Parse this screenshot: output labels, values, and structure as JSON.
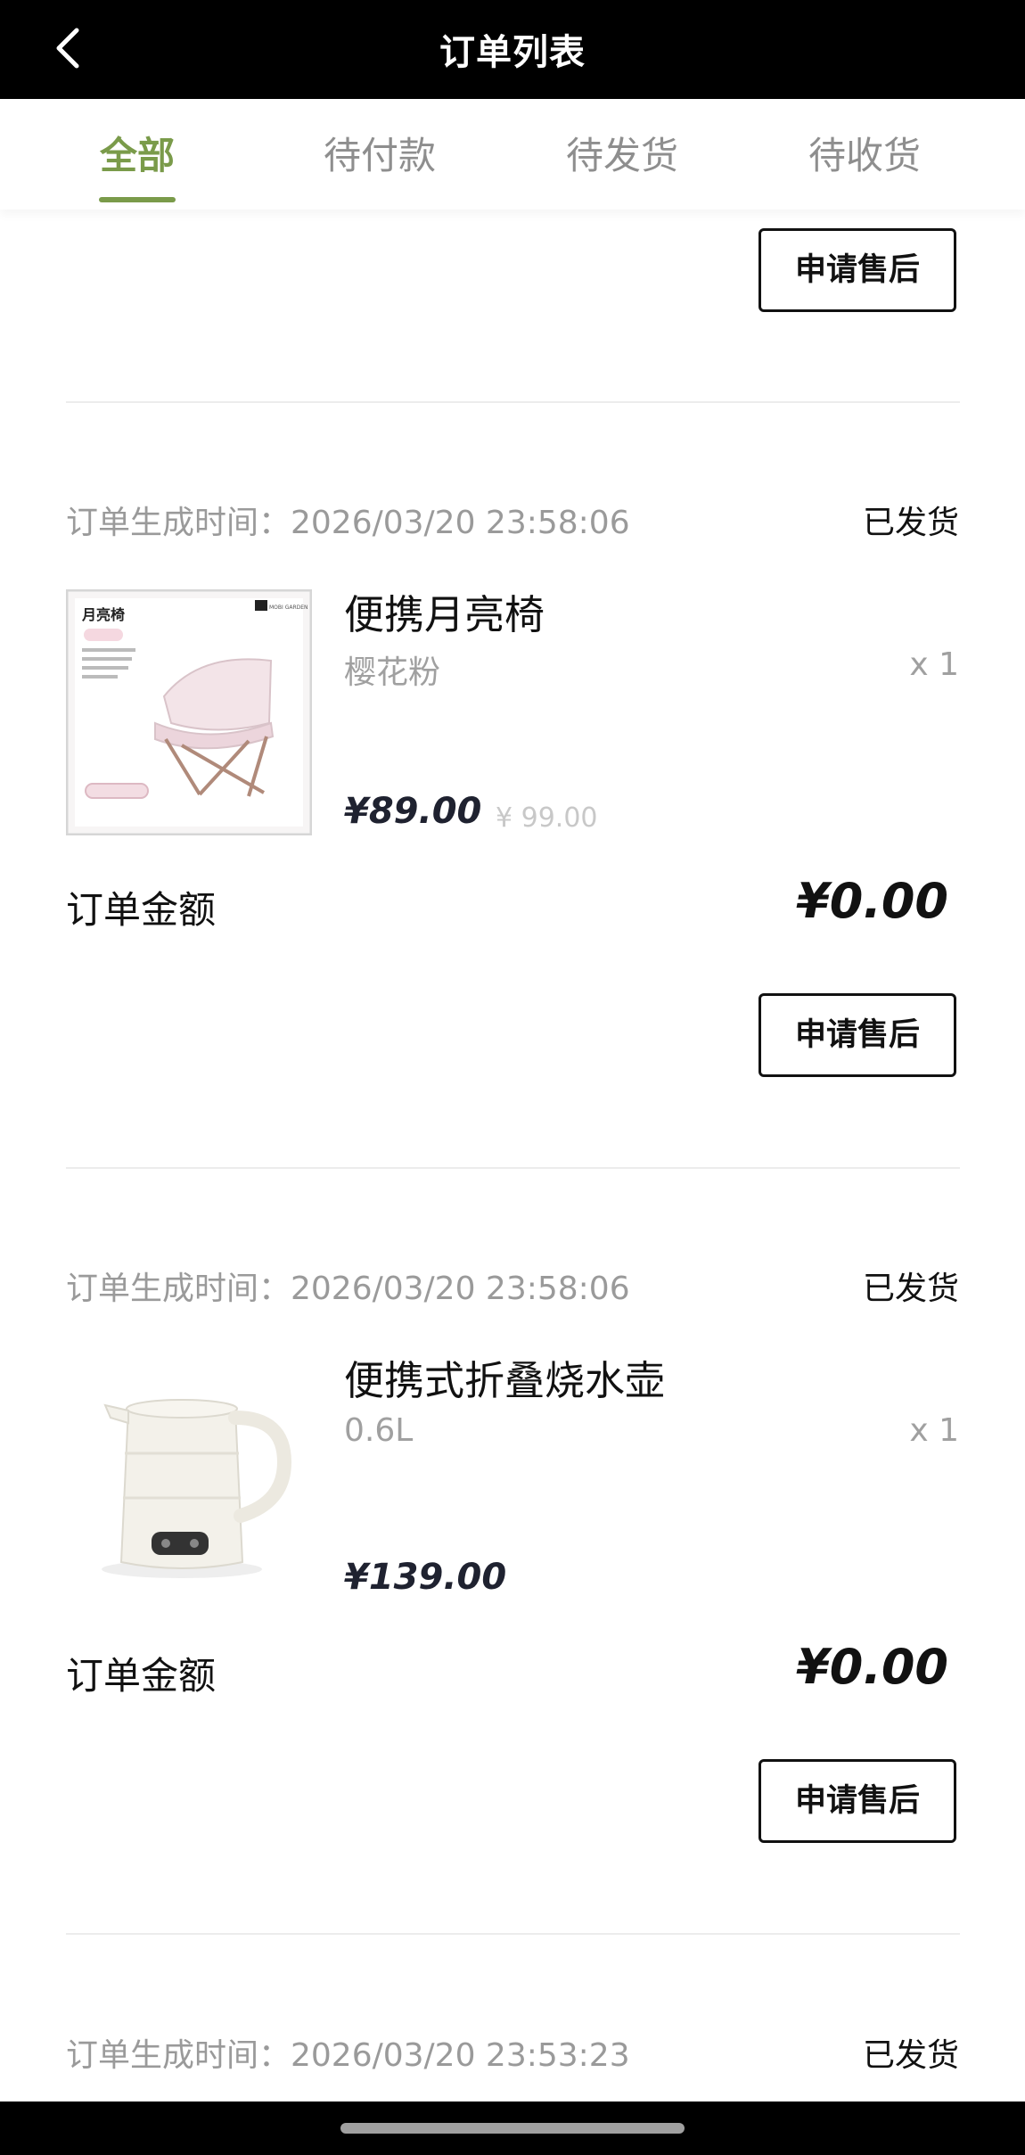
{
  "header": {
    "title": "订单列表",
    "back_icon": "chevron-left-icon"
  },
  "tabs": [
    {
      "label": "全部",
      "active": true
    },
    {
      "label": "待付款",
      "active": false
    },
    {
      "label": "待发货",
      "active": false
    },
    {
      "label": "待收货",
      "active": false
    }
  ],
  "accent_color": "#7a9b4a",
  "top_partial_order": {
    "action_label": "申请售后"
  },
  "orders": [
    {
      "time_label": "订单生成时间：2026/03/20 23:58:06",
      "status": "已发货",
      "product": {
        "name": "便携月亮椅",
        "variant": "樱花粉",
        "qty": "x 1",
        "price": "¥89.00",
        "original_price": "¥ 99.00",
        "image_icon": "moon-chair-product-image",
        "image_title": "月亮椅",
        "image_brand": "MOBI GARDEN"
      },
      "amount_label": "订单金额",
      "amount": "¥0.00",
      "action_label": "申请售后"
    },
    {
      "time_label": "订单生成时间：2026/03/20 23:58:06",
      "status": "已发货",
      "product": {
        "name": "便携式折叠烧水壶",
        "variant": "0.6L",
        "qty": "x 1",
        "price": "¥139.00",
        "image_icon": "kettle-product-image"
      },
      "amount_label": "订单金额",
      "amount": "¥0.00",
      "action_label": "申请售后"
    },
    {
      "time_label": "订单生成时间：2026/03/20 23:53:23",
      "status": "已发货"
    }
  ]
}
